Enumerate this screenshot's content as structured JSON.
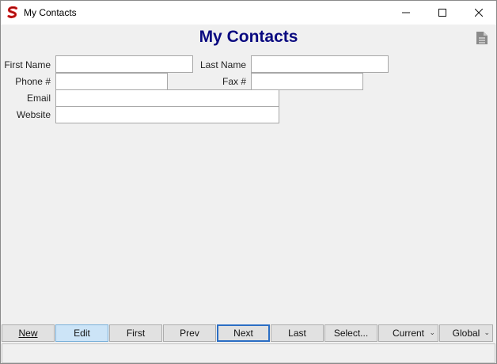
{
  "window": {
    "title": "My Contacts",
    "app_icon": "stylized-s-icon",
    "controls": [
      "minimize-icon",
      "maximize-icon",
      "close-icon"
    ]
  },
  "form": {
    "title": "My Contacts",
    "title_color": "#0a0a80",
    "corner_icon": "document-icon",
    "fields": {
      "first_name": {
        "label": "First Name",
        "value": ""
      },
      "last_name": {
        "label": "Last Name",
        "value": ""
      },
      "phone": {
        "label": "Phone #",
        "value": ""
      },
      "fax": {
        "label": "Fax #",
        "value": ""
      },
      "email": {
        "label": "Email",
        "value": ""
      },
      "website": {
        "label": "Website",
        "value": ""
      }
    }
  },
  "toolbar": {
    "new_label": "New",
    "edit_label": "Edit",
    "first_label": "First",
    "prev_label": "Prev",
    "next_label": "Next",
    "last_label": "Last",
    "select_label": "Select...",
    "current_label": "Current",
    "global_label": "Global",
    "active_button": "Edit",
    "focused_button": "Next",
    "dropdown_glyph": "⌄"
  },
  "statusbar": {
    "text": ""
  }
}
